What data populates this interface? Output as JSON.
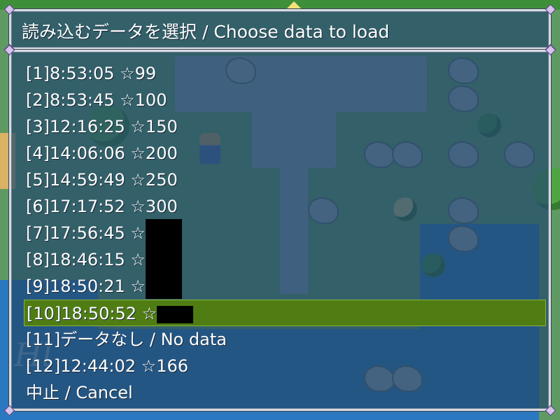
{
  "window": {
    "title": "読み込むデータを選択 / Choose data to load"
  },
  "slots": [
    {
      "label": "[1]8:53:05 ☆99",
      "selected": false,
      "redacted": false
    },
    {
      "label": "[2]8:53:45 ☆100",
      "selected": false,
      "redacted": false
    },
    {
      "label": "[3]12:16:25 ☆150",
      "selected": false,
      "redacted": false
    },
    {
      "label": "[4]14:06:06 ☆200",
      "selected": false,
      "redacted": false
    },
    {
      "label": "[5]14:59:49 ☆250",
      "selected": false,
      "redacted": false
    },
    {
      "label": "[6]17:17:52 ☆300",
      "selected": false,
      "redacted": false
    },
    {
      "label": "[7]17:56:45 ☆",
      "selected": false,
      "redacted": true
    },
    {
      "label": "[8]18:46:15 ☆",
      "selected": false,
      "redacted": true
    },
    {
      "label": "[9]18:50:21 ☆",
      "selected": false,
      "redacted": true
    },
    {
      "label": "[10]18:50:52 ☆",
      "selected": true,
      "redacted": true
    },
    {
      "label": "[11]データなし / No data",
      "selected": false,
      "redacted": false
    },
    {
      "label": "[12]12:44:02 ☆166",
      "selected": false,
      "redacted": false
    },
    {
      "label": "中止 / Cancel",
      "selected": false,
      "redacted": false
    }
  ],
  "colors": {
    "window_bg": "#234a6c",
    "window_border": "#d8dde4",
    "selection": "#4f7d14",
    "text": "#ffffff"
  },
  "icons": [
    "scroll-up-arrow-icon",
    "window-corner-gem-icon"
  ]
}
